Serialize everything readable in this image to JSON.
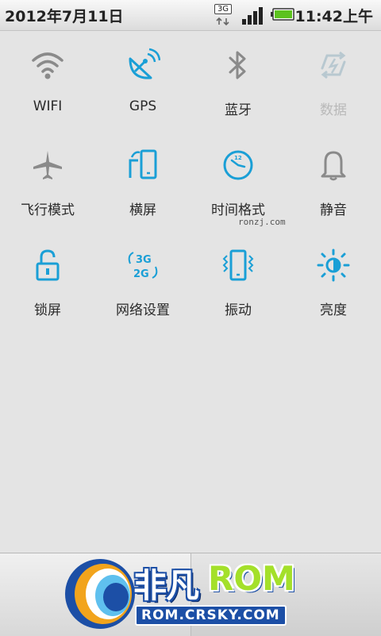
{
  "status_bar": {
    "date": "2012年7月11日",
    "network_type": "3G",
    "time": "11:42上午",
    "icons": [
      "network-3g-icon",
      "signal-icon",
      "battery-icon"
    ]
  },
  "tiles": [
    {
      "label": "WIFI",
      "icon": "wifi-icon",
      "enabled": false
    },
    {
      "label": "GPS",
      "icon": "gps-satellite-icon",
      "enabled": true
    },
    {
      "label": "蓝牙",
      "icon": "bluetooth-icon",
      "enabled": false
    },
    {
      "label": "数据",
      "icon": "mobile-data-icon",
      "enabled": false,
      "dimmed": true
    },
    {
      "label": "飞行模式",
      "icon": "airplane-icon",
      "enabled": false
    },
    {
      "label": "横屏",
      "icon": "rotation-icon",
      "enabled": true
    },
    {
      "label": "时间格式",
      "icon": "clock-icon",
      "enabled": true
    },
    {
      "label": "静音",
      "icon": "bell-icon",
      "enabled": false
    },
    {
      "label": "锁屏",
      "icon": "lock-icon",
      "enabled": true
    },
    {
      "label": "网络设置",
      "icon": "network-3g-2g-icon",
      "enabled": true
    },
    {
      "label": "振动",
      "icon": "vibrate-icon",
      "enabled": true
    },
    {
      "label": "亮度",
      "icon": "brightness-icon",
      "enabled": true
    }
  ],
  "watermark": "ronzj.com",
  "logo": {
    "name_cn": "非凡",
    "name_rom": "ROM",
    "url": "ROM.CRSKY.COM"
  },
  "colors": {
    "accent": "#1a9fd6",
    "inactive": "#8a8a8a",
    "dimmed": "#b8c8d0",
    "background": "#e4e4e4"
  }
}
